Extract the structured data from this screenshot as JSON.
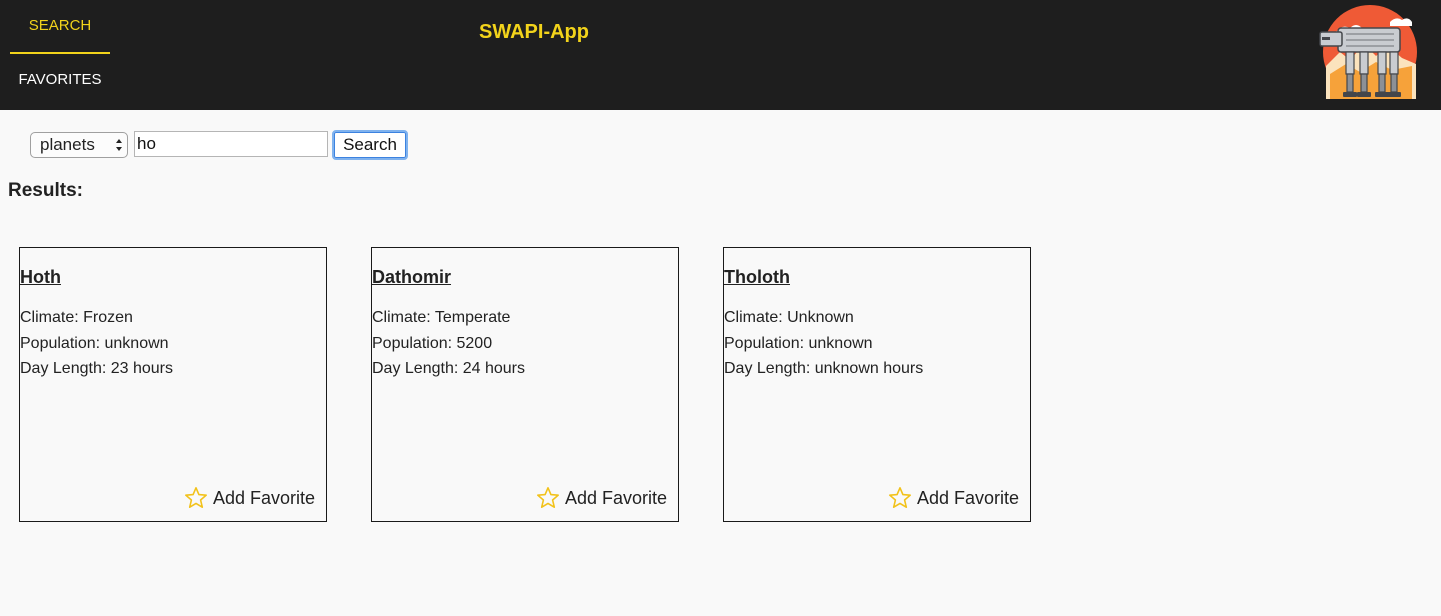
{
  "header": {
    "tabs": [
      {
        "label": "SEARCH",
        "active": true
      },
      {
        "label": "FAVORITES",
        "active": false
      }
    ],
    "title": "SWAPI-App",
    "logo_icon": "at-at-walker-logo-icon",
    "accent_color": "#f2d31b"
  },
  "search": {
    "type_selected": "planets",
    "query_value": "ho",
    "button_label": "Search"
  },
  "results": {
    "heading": "Results:",
    "cards": [
      {
        "name": "Hoth",
        "climate": "Climate: Frozen",
        "population": "Population: unknown",
        "day_length": "Day Length: 23 hours",
        "favorite_label": "Add Favorite",
        "favorite_icon": "star-outline-icon"
      },
      {
        "name": "Dathomir",
        "climate": "Climate: Temperate",
        "population": "Population: 5200",
        "day_length": "Day Length: 24 hours",
        "favorite_label": "Add Favorite",
        "favorite_icon": "star-outline-icon"
      },
      {
        "name": "Tholoth",
        "climate": "Climate: Unknown",
        "population": "Population: unknown",
        "day_length": "Day Length: unknown hours",
        "favorite_label": "Add Favorite",
        "favorite_icon": "star-outline-icon"
      }
    ]
  }
}
